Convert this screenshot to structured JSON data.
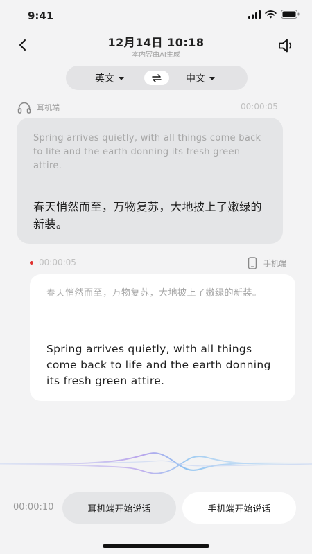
{
  "status_bar": {
    "time": "9:41"
  },
  "header": {
    "title": "12月14日 10:18",
    "subtitle": "本内容由AI生成",
    "back_icon": "chevron-left-icon",
    "speaker_icon": "speaker-icon"
  },
  "language_switch": {
    "source": "英文",
    "target": "中文",
    "swap_icon": "swap-arrows-icon"
  },
  "earphone_message": {
    "device_label": "耳机端",
    "device_icon": "headphones-icon",
    "duration": "00:00:05",
    "original_text": "Spring arrives quietly, with all things come back to life and the earth donning its fresh green attire.",
    "translated_text": "春天悄然而至，万物复苏，大地披上了嫩绿的新装。"
  },
  "phone_message": {
    "device_label": "手机端",
    "device_icon": "phone-icon",
    "duration": "00:00:05",
    "recording_indicator_color": "#e0312f",
    "original_text": "春天悄然而至，万物复苏，大地披上了嫩绿的新装。",
    "translated_text": "Spring arrives quietly, with all things come back to life and the earth donning its fresh green attire."
  },
  "bottom_controls": {
    "elapsed_time": "00:00:10",
    "earphone_button": "耳机端开始说话",
    "phone_button": "手机端开始说话"
  },
  "colors": {
    "background": "#f3f3f4",
    "earphone_card": "#e4e5e7",
    "phone_card": "#ffffff",
    "wave_accent_1": "#b9a4ec",
    "wave_accent_2": "#8ec3f1"
  }
}
